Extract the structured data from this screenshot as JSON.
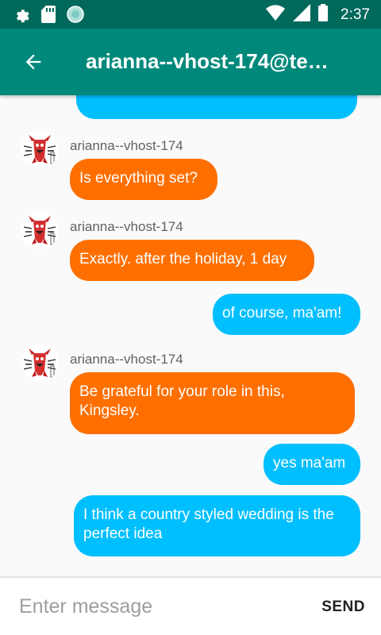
{
  "status_bar": {
    "time": "2:37",
    "icons": [
      "gear-icon",
      "sd-card-icon",
      "sync-circle-icon",
      "wifi-icon",
      "signal-icon",
      "battery-icon"
    ]
  },
  "app_bar": {
    "title": "arianna--vhost-174@te…",
    "back_icon": "arrow-left-icon"
  },
  "messages": [
    {
      "direction": "outgoing",
      "text": ""
    },
    {
      "direction": "incoming",
      "sender": "arianna--vhost-174",
      "text": "Is everything set?"
    },
    {
      "direction": "incoming",
      "sender": "arianna--vhost-174",
      "text": "Exactly. after the holiday, 1 day"
    },
    {
      "direction": "outgoing",
      "text": "of course, ma'am!"
    },
    {
      "direction": "incoming",
      "sender": "arianna--vhost-174",
      "text": "Be grateful for your role in this, Kingsley."
    },
    {
      "direction": "outgoing",
      "text": "yes ma'am"
    },
    {
      "direction": "outgoing",
      "text": "I think a country styled wedding is the perfect idea"
    }
  ],
  "composer": {
    "placeholder": "Enter message",
    "send_label": "SEND"
  },
  "colors": {
    "status_bar": "#00695c",
    "app_bar": "#00897b",
    "incoming_bubble": "#ff6f00",
    "outgoing_bubble": "#00bfff"
  }
}
